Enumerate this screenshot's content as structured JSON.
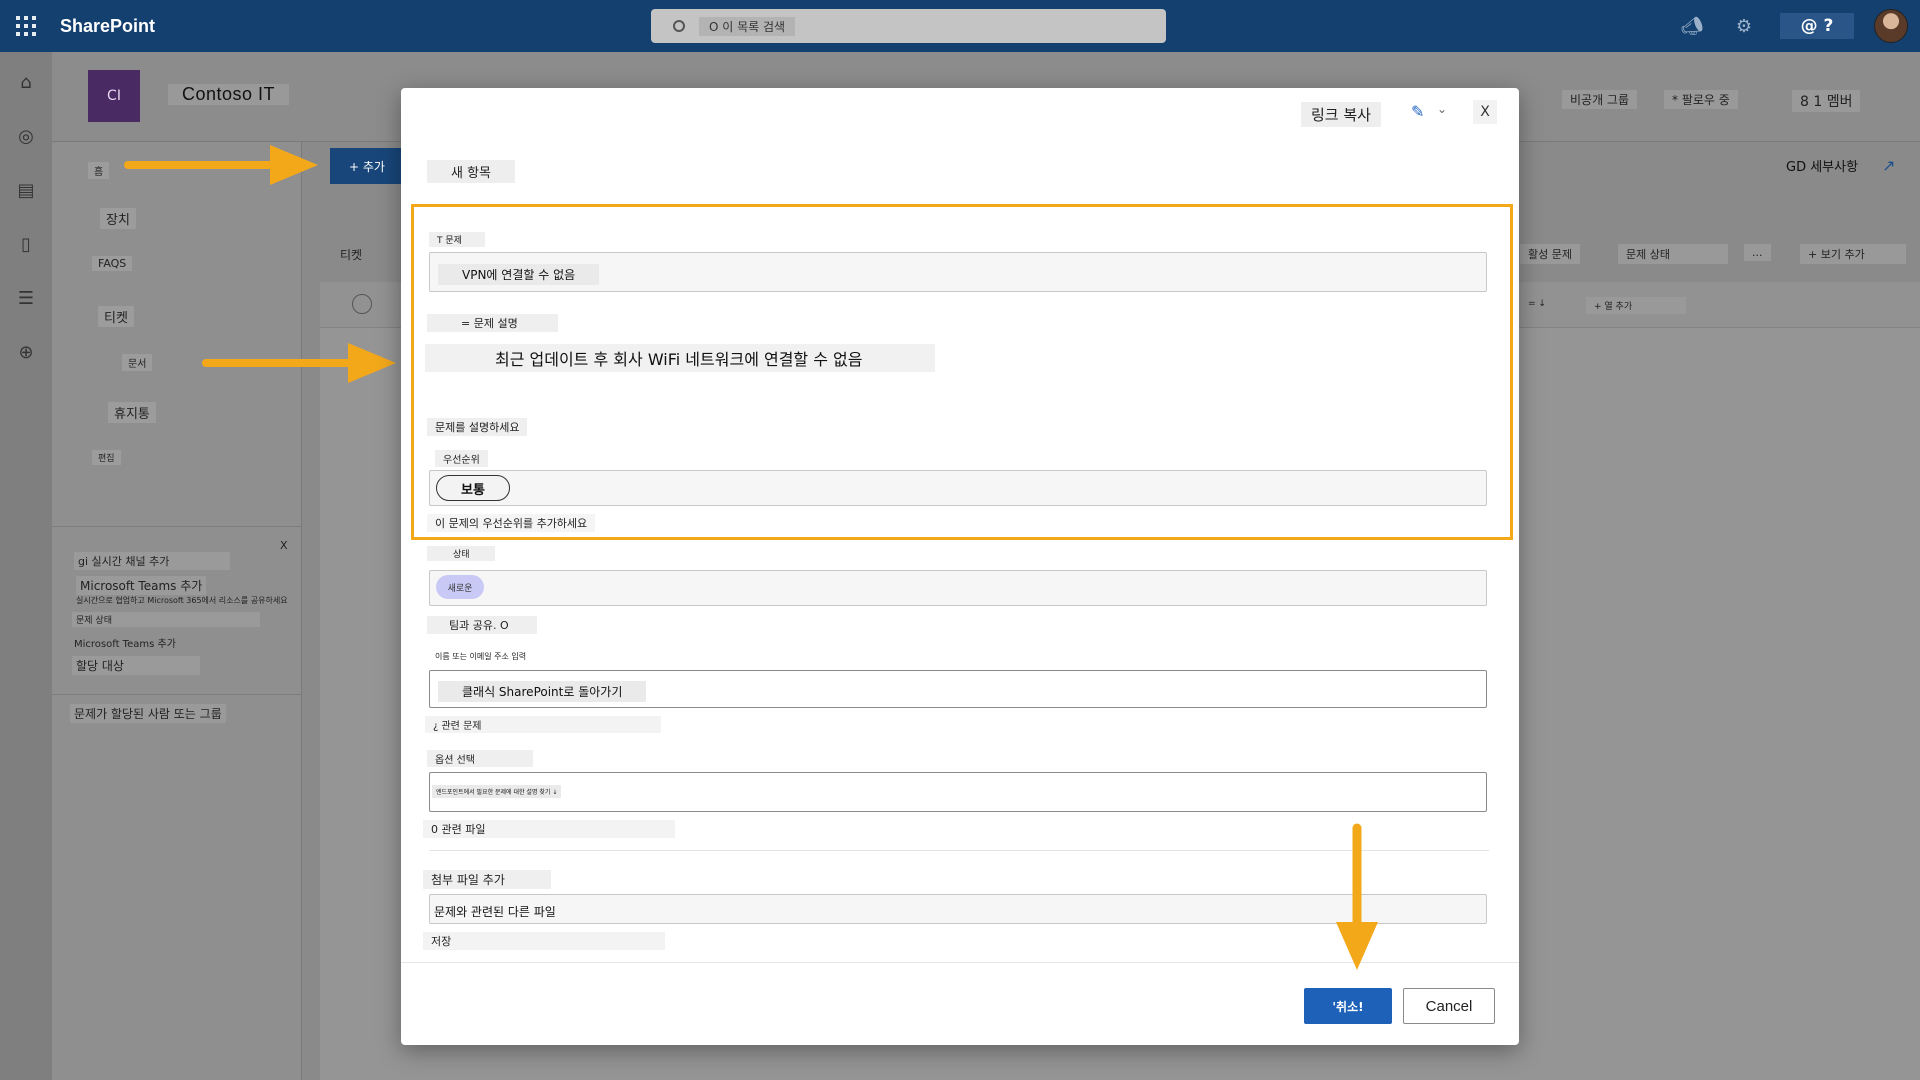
{
  "suite": {
    "app_name": "SharePoint",
    "search_placeholder": "O 이 목록 검색",
    "help_label": "@ ?"
  },
  "site": {
    "logo_text": "CI",
    "title": "Contoso IT",
    "header_right": [
      "비공개 그룹",
      "* 팔로우 중",
      "8 1 멤버"
    ]
  },
  "left_nav": {
    "items": [
      "흠",
      "장치",
      "FAQS",
      "티켓",
      "문서",
      "휴지통",
      "편집"
    ],
    "panel_close": "X",
    "panel_items": [
      "gi 실시간 채널 추가",
      "Microsoft Teams 추가",
      "실시간으로 협업하고 Microsoft 365에서 리소스를 공유하세요",
      "문제 상태",
      "Microsoft Teams 추가",
      "할당 대상"
    ],
    "bottom_item": "문제가 할당된 사람 또는 그룹"
  },
  "command_bar": {
    "add_button": "+ 추가",
    "right_label": "GD 세부사항"
  },
  "views": {
    "left_tab": "티켓",
    "tabs": [
      "활성 문제",
      "문제 상태",
      "...",
      "+ 보기 추가"
    ],
    "col_left": "= ↓",
    "col_add": "+ 열 추가"
  },
  "dialog": {
    "copy_link": "링크 복사",
    "close": "X",
    "title": "새 항목",
    "fields": {
      "issue_label": "T 문제",
      "issue_value": "VPN에 연결할 수 없음",
      "desc_label": "= 문제 설명",
      "desc_value": "최근 업데이트 후 회사 WiFi 네트워크에 연결할 수 없음",
      "desc_hint": "문제를 설명하세요",
      "priority_label": "우선순위",
      "priority_value": "보통",
      "priority_hint": "이 문제의 우선순위를 추가하세요",
      "status_label": "상태",
      "status_value": "새로운",
      "status_hint": "팀과 공유. O",
      "assigned_label": "이름 또는 이메일 주소 입력",
      "assigned_value": "클래식 SharePoint로 돌아가기",
      "related_label": "¿ 관련 문제",
      "options_label": "옵션 선택",
      "options_value": "엔드포인트에서 필요한 문제에 대한 설명 찾기 ↓",
      "files_label": "0 관련 파일",
      "attach_label": "첨부 파일 추가",
      "attach_value": "문제와 관련된 다른 파일",
      "save_label": "저장"
    },
    "primary_button": "'취소!",
    "cancel_button": "Cancel"
  },
  "colors": {
    "suite_bar": "#13406f",
    "accent": "#1d62b8",
    "highlight": "#f3a81a",
    "arrow": "#f3a81a"
  }
}
